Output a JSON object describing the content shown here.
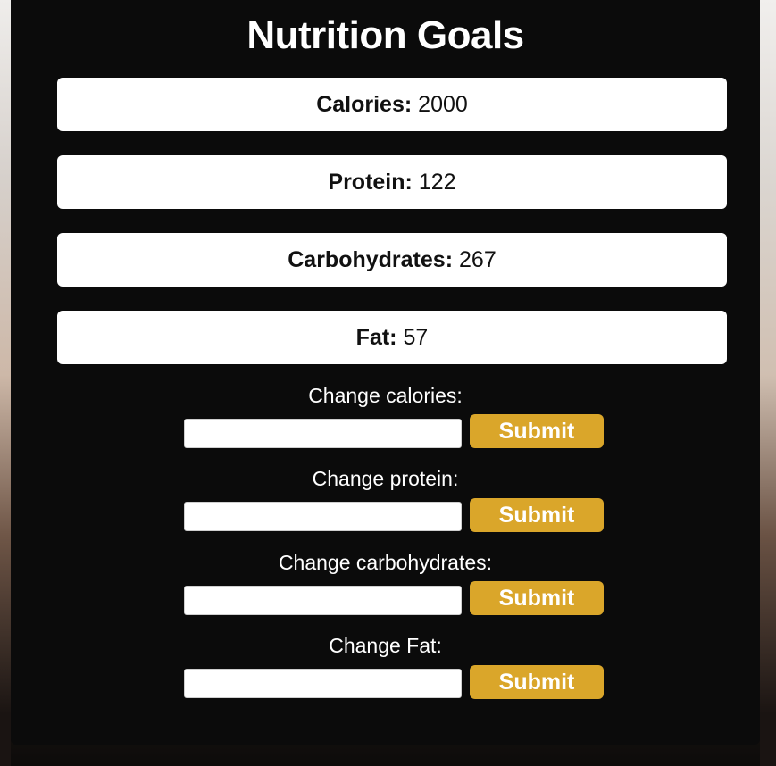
{
  "page": {
    "title": "Nutrition Goals"
  },
  "goals": [
    {
      "label": "Calories:",
      "value": "2000"
    },
    {
      "label": "Protein:",
      "value": "122"
    },
    {
      "label": "Carbohydrates:",
      "value": "267"
    },
    {
      "label": "Fat:",
      "value": "57"
    }
  ],
  "forms": [
    {
      "label": "Change calories:",
      "input_value": "",
      "button_label": "Submit"
    },
    {
      "label": "Change protein:",
      "input_value": "",
      "button_label": "Submit"
    },
    {
      "label": "Change carbohydrates:",
      "input_value": "",
      "button_label": "Submit"
    },
    {
      "label": "Change Fat:",
      "input_value": "",
      "button_label": "Submit"
    }
  ],
  "colors": {
    "panel_background": "#0b0b0b",
    "card_background": "#ffffff",
    "button_accent": "#daa62a",
    "text_light": "#ffffff",
    "text_dark": "#111111"
  }
}
